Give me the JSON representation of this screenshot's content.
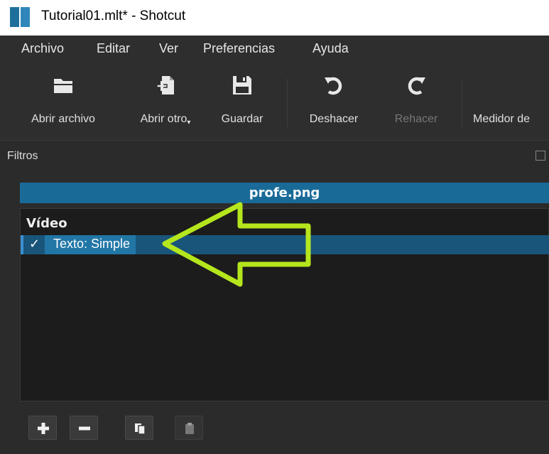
{
  "window": {
    "title": "Tutorial01.mlt* - Shotcut",
    "app_icon": "shotcut-logo-icon"
  },
  "menu": [
    {
      "label": "Archivo"
    },
    {
      "label": "Editar"
    },
    {
      "label": "Ver"
    },
    {
      "label": "Preferencias"
    },
    {
      "label": "Ayuda"
    }
  ],
  "toolbar": {
    "open_file": {
      "label": "Abrir archivo",
      "icon": "folder-icon"
    },
    "open_other": {
      "label": "Abrir otro",
      "icon": "file-plus-icon"
    },
    "save": {
      "label": "Guardar",
      "icon": "save-icon"
    },
    "undo": {
      "label": "Deshacer",
      "icon": "undo-icon"
    },
    "redo": {
      "label": "Rehacer",
      "icon": "redo-icon"
    },
    "meter": {
      "label": "Medidor de"
    }
  },
  "filters_panel": {
    "title": "Filtros",
    "clip_name": "profe.png",
    "section_label": "Vídeo",
    "filters": [
      {
        "check": "✓",
        "label": "Texto: Simple"
      }
    ]
  },
  "colors": {
    "accent_blue": "#2176a6",
    "arrow": "#b5e61d"
  }
}
